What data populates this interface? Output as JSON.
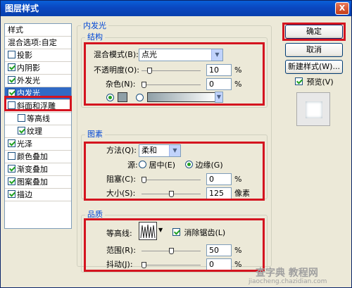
{
  "window": {
    "title": "图层样式",
    "close_label": "X"
  },
  "style_list": {
    "items": [
      {
        "label": "样式",
        "has_checkbox": false,
        "checked": false,
        "indent": false,
        "active": false
      },
      {
        "label": "混合选项:自定",
        "has_checkbox": false,
        "checked": false,
        "indent": false,
        "active": false
      },
      {
        "label": "投影",
        "has_checkbox": true,
        "checked": false,
        "indent": false,
        "active": false
      },
      {
        "label": "内阴影",
        "has_checkbox": true,
        "checked": true,
        "indent": false,
        "active": false
      },
      {
        "label": "外发光",
        "has_checkbox": true,
        "checked": true,
        "indent": false,
        "active": false
      },
      {
        "label": "内发光",
        "has_checkbox": true,
        "checked": true,
        "indent": false,
        "active": true
      },
      {
        "label": "斜面和浮雕",
        "has_checkbox": true,
        "checked": false,
        "indent": false,
        "active": false
      },
      {
        "label": "等高线",
        "has_checkbox": true,
        "checked": false,
        "indent": true,
        "active": false
      },
      {
        "label": "纹理",
        "has_checkbox": true,
        "checked": true,
        "indent": true,
        "active": false
      },
      {
        "label": "光泽",
        "has_checkbox": true,
        "checked": true,
        "indent": false,
        "active": false
      },
      {
        "label": "颜色叠加",
        "has_checkbox": true,
        "checked": false,
        "indent": false,
        "active": false
      },
      {
        "label": "渐变叠加",
        "has_checkbox": true,
        "checked": true,
        "indent": false,
        "active": false
      },
      {
        "label": "图案叠加",
        "has_checkbox": true,
        "checked": true,
        "indent": false,
        "active": false
      },
      {
        "label": "描边",
        "has_checkbox": true,
        "checked": true,
        "indent": false,
        "active": false
      }
    ]
  },
  "inner_glow": {
    "title": "内发光",
    "structure": {
      "title": "结构",
      "blend_mode_label": "混合模式(B):",
      "blend_mode_value": "点光",
      "opacity_label": "不透明度(O):",
      "opacity_value": "10",
      "opacity_fraction": 0.1,
      "noise_label": "杂色(N):",
      "noise_value": "0",
      "noise_fraction": 0.0,
      "percent": "%"
    },
    "elements": {
      "title": "图素",
      "technique_label": "方法(Q):",
      "technique_value": "柔和",
      "source_label": "源:",
      "source_center_label": "居中(E)",
      "source_edge_label": "边缘(G)",
      "source_selected": "edge",
      "choke_label": "阻塞(C):",
      "choke_value": "0",
      "choke_fraction": 0.0,
      "size_label": "大小(S):",
      "size_value": "125",
      "size_fraction": 0.5,
      "percent": "%",
      "pixels": "像素"
    },
    "quality": {
      "title": "品质",
      "contour_label": "等高线:",
      "anti_alias_label": "消除锯齿(L)",
      "anti_alias_checked": true,
      "range_label": "范围(R):",
      "range_value": "50",
      "range_fraction": 0.5,
      "jitter_label": "抖动(J):",
      "jitter_value": "0",
      "jitter_fraction": 0.0,
      "percent": "%"
    }
  },
  "buttons": {
    "ok": "确定",
    "cancel": "取消",
    "new_style": "新建样式(W)...",
    "preview_label": "预览(V)",
    "preview_checked": true
  },
  "watermark": {
    "line1": "查字典 教程网",
    "line2": "jiaocheng.chazidian.com"
  },
  "colors": {
    "highlight_red": "#d4141f",
    "glow_color": "#8fa0a7",
    "selection_blue": "#316ac5"
  }
}
